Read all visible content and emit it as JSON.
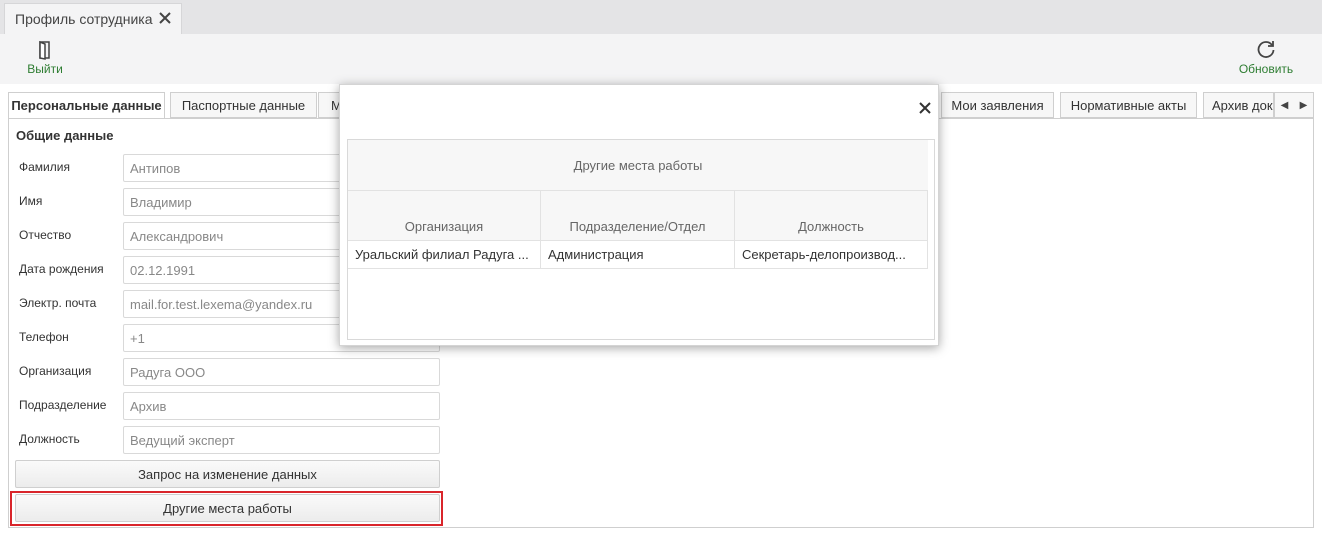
{
  "doc_tab": {
    "title": "Профиль сотрудника"
  },
  "toolbar": {
    "exit_label": "Выйти",
    "refresh_label": "Обновить",
    "accent": "#2e7d32"
  },
  "tabs": [
    {
      "label": "Персональные данные"
    },
    {
      "label": "Паспортные данные"
    },
    {
      "label": "М"
    },
    {
      "label": "Мои заявления"
    },
    {
      "label": "Нормативные акты"
    },
    {
      "label": "Архив док"
    }
  ],
  "section_title": "Общие данные",
  "fields": [
    {
      "label": "Фамилия",
      "value": "Антипов"
    },
    {
      "label": "Имя",
      "value": "Владимир"
    },
    {
      "label": "Отчество",
      "value": "Александрович"
    },
    {
      "label": "Дата рождения",
      "value": "02.12.1991"
    },
    {
      "label": "Электр. почта",
      "value": "mail.for.test.lexema@yandex.ru"
    },
    {
      "label": "Телефон",
      "value": "+1"
    },
    {
      "label": "Организация",
      "value": "Радуга ООО"
    },
    {
      "label": "Подразделение",
      "value": "Архив"
    },
    {
      "label": "Должность",
      "value": "Ведущий эксперт"
    }
  ],
  "buttons": {
    "change_request": "Запрос на изменение данных",
    "other_workplaces": "Другие места работы"
  },
  "modal": {
    "grid_title": "Другие места работы",
    "columns": [
      "Организация",
      "Подразделение/Отдел",
      "Должность"
    ],
    "rows": [
      [
        "Уральский филиал Радуга ...",
        "Администрация",
        "Секретарь-делопроизвод..."
      ]
    ]
  },
  "colors": {
    "highlight": "#d9252b"
  }
}
